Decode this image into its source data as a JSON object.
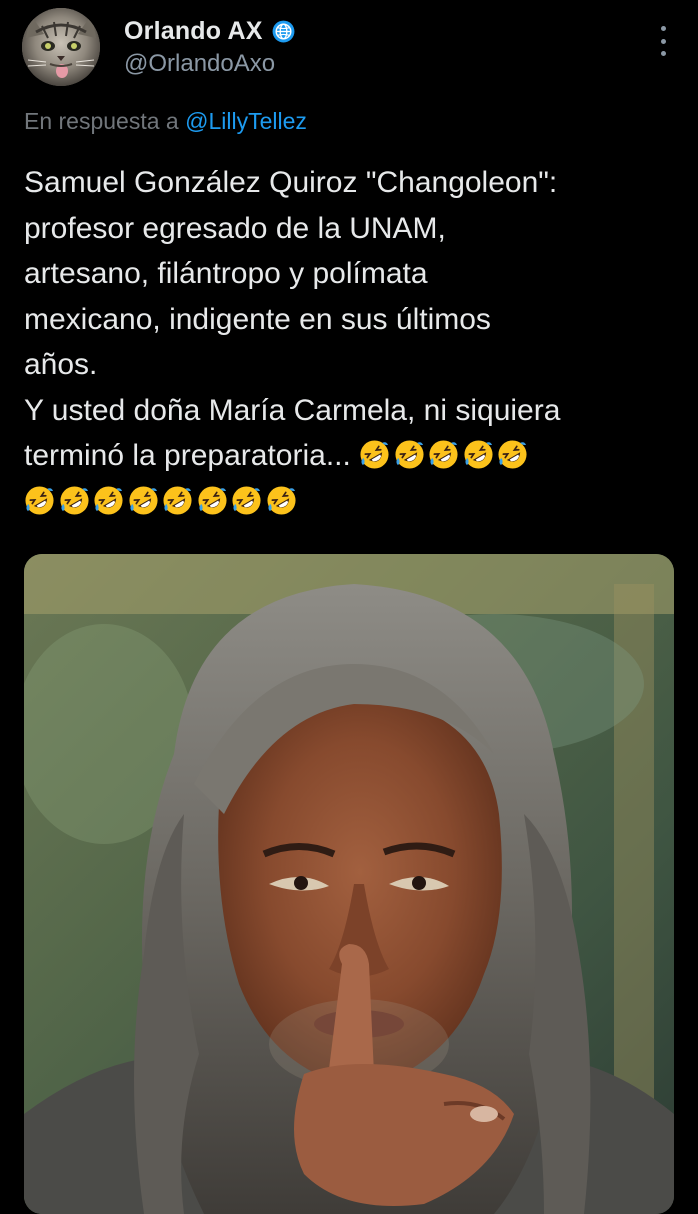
{
  "author": {
    "display_name": "Orlando AX",
    "handle": "@OrlandoAxo",
    "verified": true,
    "avatar_icon": "cat-avatar",
    "verified_icon": "verified-badge-icon"
  },
  "reply": {
    "prefix": "En respuesta a ",
    "mention": "@LillyTellez"
  },
  "body": {
    "lines": [
      "Samuel González Quiroz \"Changoleon\":",
      "profesor egresado de la UNAM,",
      "artesano, filántropo y polímata",
      "mexicano, indigente en sus últimos",
      "años.",
      "Y usted doña María Carmela, ni siquiera",
      "terminó la preparatoria..."
    ],
    "emoji_name": "rolling-on-the-floor-laughing",
    "emoji_count_line7": 5,
    "emoji_count_line8": 8
  },
  "media": {
    "type": "photo",
    "icon": "photo-long-haired-man-shushing"
  },
  "colors": {
    "background": "#000000",
    "text": "#e7e9ea",
    "secondary": "#71767b",
    "handle": "#8b98a5",
    "link": "#1d9bf0",
    "verified": "#1d9bf0"
  }
}
